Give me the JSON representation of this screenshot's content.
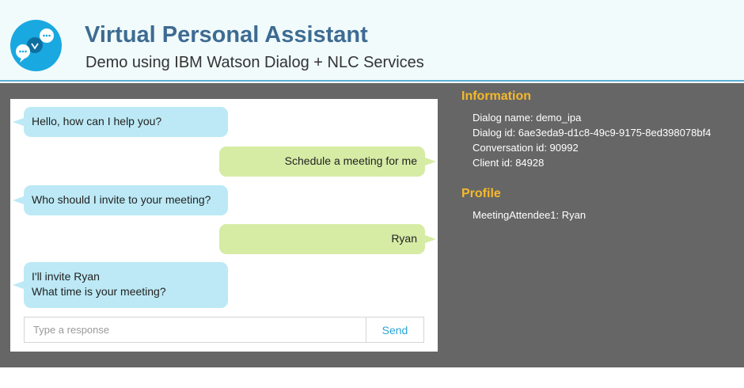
{
  "header": {
    "title": "Virtual Personal Assistant",
    "subtitle": "Demo using IBM Watson Dialog + NLC Services",
    "logo_icon": "chat-bubbles-icon",
    "accent_color": "#1aa8e0"
  },
  "chat": {
    "messages": [
      {
        "sender": "bot",
        "lines": [
          "Hello, how can I help you?"
        ]
      },
      {
        "sender": "user",
        "lines": [
          "Schedule a meeting for me"
        ]
      },
      {
        "sender": "bot",
        "lines": [
          "Who should I invite to your meeting?"
        ]
      },
      {
        "sender": "user",
        "lines": [
          "Ryan"
        ]
      },
      {
        "sender": "bot",
        "lines": [
          "I'll invite Ryan",
          "What time is your meeting?"
        ]
      }
    ],
    "input": {
      "placeholder": "Type a response",
      "value": ""
    },
    "send_label": "Send"
  },
  "information": {
    "title": "Information",
    "lines": [
      "Dialog name: demo_ipa",
      "Dialog id: 6ae3eda9-d1c8-49c9-9175-8ed398078bf4",
      "Conversation id: 90992",
      "Client id: 84928"
    ]
  },
  "profile": {
    "title": "Profile",
    "lines": [
      "MeetingAttendee1: Ryan"
    ]
  }
}
